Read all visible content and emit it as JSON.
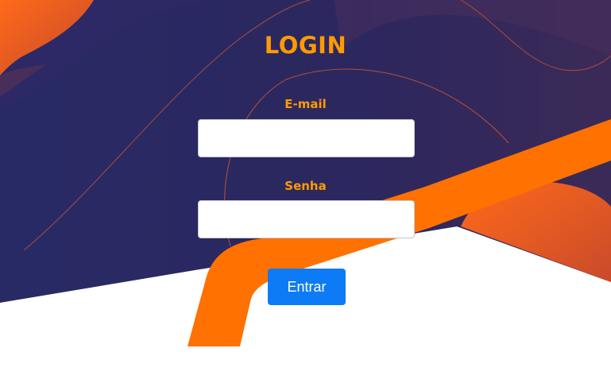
{
  "login": {
    "title": "LOGIN",
    "email_label": "E-mail",
    "email_value": "",
    "password_label": "Senha",
    "password_value": "",
    "submit_label": "Entrar"
  },
  "colors": {
    "background_navy": "#262763",
    "accent_orange": "#ff7100",
    "label_orange": "#ff9a00",
    "button_blue": "#0d7bf6"
  }
}
